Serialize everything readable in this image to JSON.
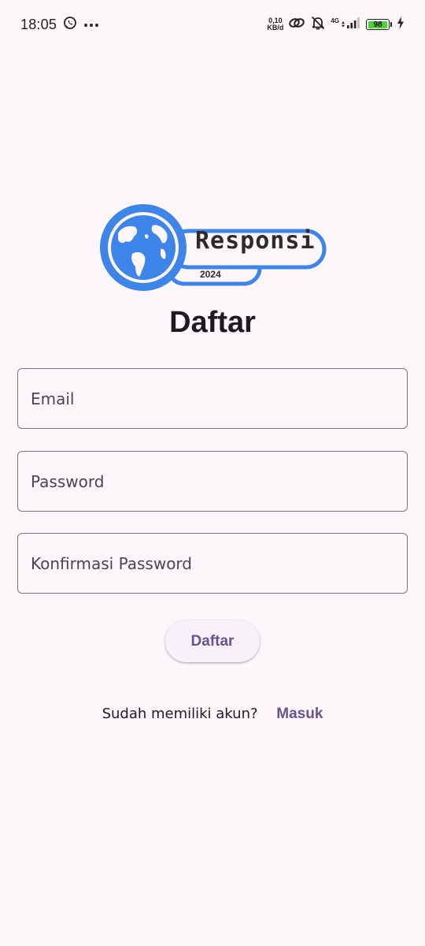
{
  "status_bar": {
    "time": "18:05",
    "net_speed_value": "0,10",
    "net_speed_unit": "KB/d",
    "network_type": "4G",
    "battery_level": "98",
    "battery_fraction": 0.98,
    "battery_color": "#4cd137"
  },
  "logo": {
    "brand_text": "Responsi",
    "year_text": "2024",
    "accent_color": "#3d85e8"
  },
  "page": {
    "title": "Daftar"
  },
  "form": {
    "email_placeholder": "Email",
    "password_placeholder": "Password",
    "confirm_placeholder": "Konfirmasi Password",
    "submit_label": "Daftar"
  },
  "footer": {
    "question": "Sudah memiliki akun?",
    "login_link": "Masuk"
  },
  "colors": {
    "background": "#fdf7fc",
    "primary": "#65558f",
    "outline": "#79747e"
  }
}
